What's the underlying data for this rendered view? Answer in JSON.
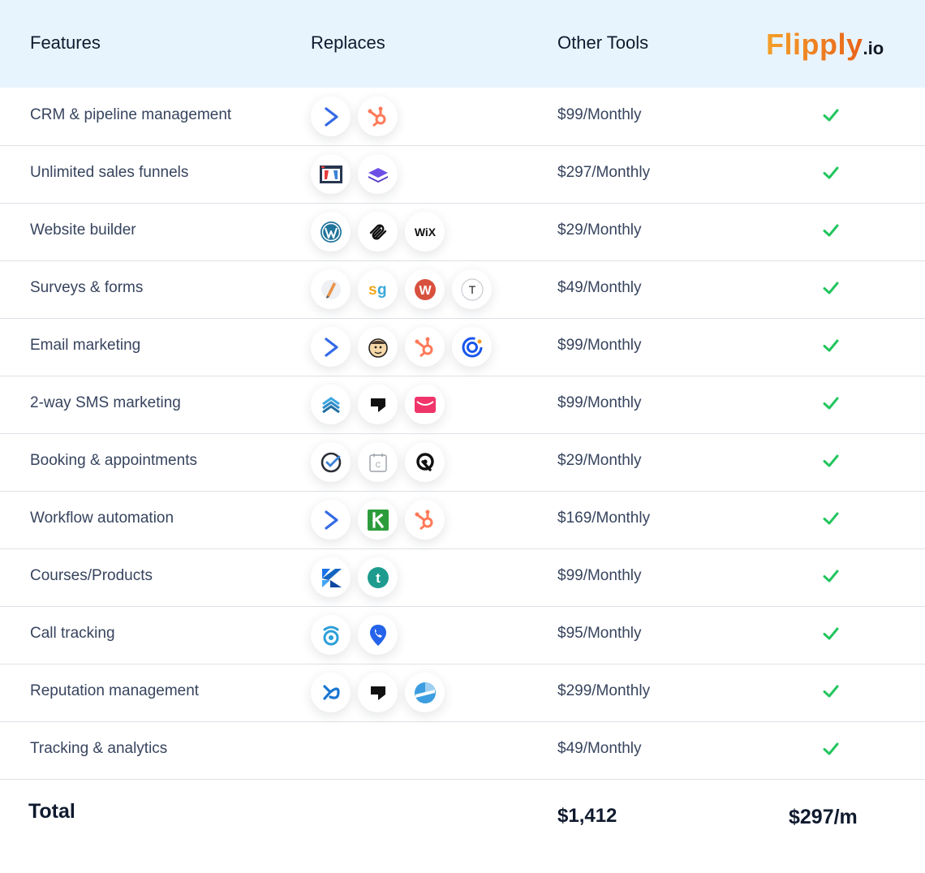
{
  "header": {
    "features": "Features",
    "replaces": "Replaces",
    "other_tools": "Other Tools",
    "logo_main": "Flipply",
    "logo_tld": ".io"
  },
  "colors": {
    "header_bg": "#e8f4fd",
    "check": "#22c55e",
    "logo_orange": "#f07a1a"
  },
  "rows": [
    {
      "feature": "CRM & pipeline management",
      "price": "$99/Monthly",
      "icons": [
        "activecampaign-icon",
        "hubspot-icon"
      ]
    },
    {
      "feature": "Unlimited sales funnels",
      "price": "$297/Monthly",
      "icons": [
        "clickfunnels-icon",
        "leadpages-icon"
      ]
    },
    {
      "feature": "Website builder",
      "price": "$29/Monthly",
      "icons": [
        "wordpress-icon",
        "squarespace-icon",
        "wix-icon"
      ]
    },
    {
      "feature": "Surveys & forms",
      "price": "$49/Monthly",
      "icons": [
        "jotform-icon",
        "surveygizmo-icon",
        "wufoo-icon",
        "typeform-icon"
      ]
    },
    {
      "feature": "Email marketing",
      "price": "$99/Monthly",
      "icons": [
        "activecampaign-icon",
        "mailchimp-icon",
        "hubspot-icon",
        "constantcontact-icon"
      ]
    },
    {
      "feature": "2-way SMS marketing",
      "price": "$99/Monthly",
      "icons": [
        "simpletexting-icon",
        "podium-icon",
        "textmagic-icon"
      ]
    },
    {
      "feature": "Booking & appointments",
      "price": "$29/Monthly",
      "icons": [
        "acuity-icon",
        "calendly-icon",
        "setmore-icon"
      ]
    },
    {
      "feature": "Workflow automation",
      "price": "$169/Monthly",
      "icons": [
        "activecampaign-icon",
        "keap-icon",
        "hubspot-icon"
      ]
    },
    {
      "feature": "Courses/Products",
      "price": "$99/Monthly",
      "icons": [
        "kajabi-icon",
        "teachable-icon"
      ]
    },
    {
      "feature": "Call tracking",
      "price": "$95/Monthly",
      "icons": [
        "callrail-icon",
        "calltracking-pin-icon"
      ]
    },
    {
      "feature": "Reputation management",
      "price": "$299/Monthly",
      "icons": [
        "birdeye-icon",
        "podium-icon",
        "reputation-icon"
      ]
    },
    {
      "feature": "Tracking & analytics",
      "price": "$49/Monthly",
      "icons": []
    }
  ],
  "totals": {
    "label": "Total",
    "other_tools": "$1,412",
    "flipply": "$297/m"
  }
}
